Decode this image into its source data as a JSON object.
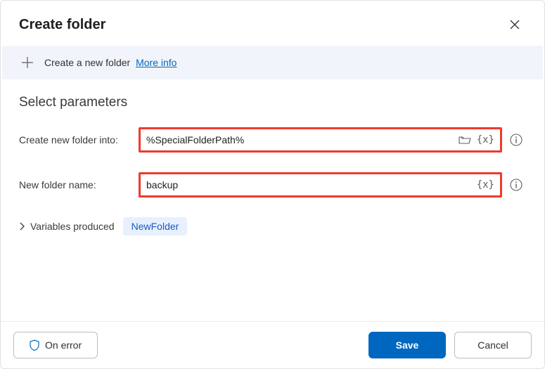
{
  "dialog": {
    "title": "Create folder",
    "info_bar": {
      "text": "Create a new folder",
      "link": "More info"
    },
    "section_title": "Select parameters",
    "params": {
      "folder_into": {
        "label": "Create new folder into:",
        "value": "%SpecialFolderPath%"
      },
      "folder_name": {
        "label": "New folder name:",
        "value": "backup"
      }
    },
    "variables_produced": {
      "label": "Variables produced",
      "chip": "NewFolder"
    },
    "footer": {
      "on_error": "On error",
      "save": "Save",
      "cancel": "Cancel"
    }
  }
}
